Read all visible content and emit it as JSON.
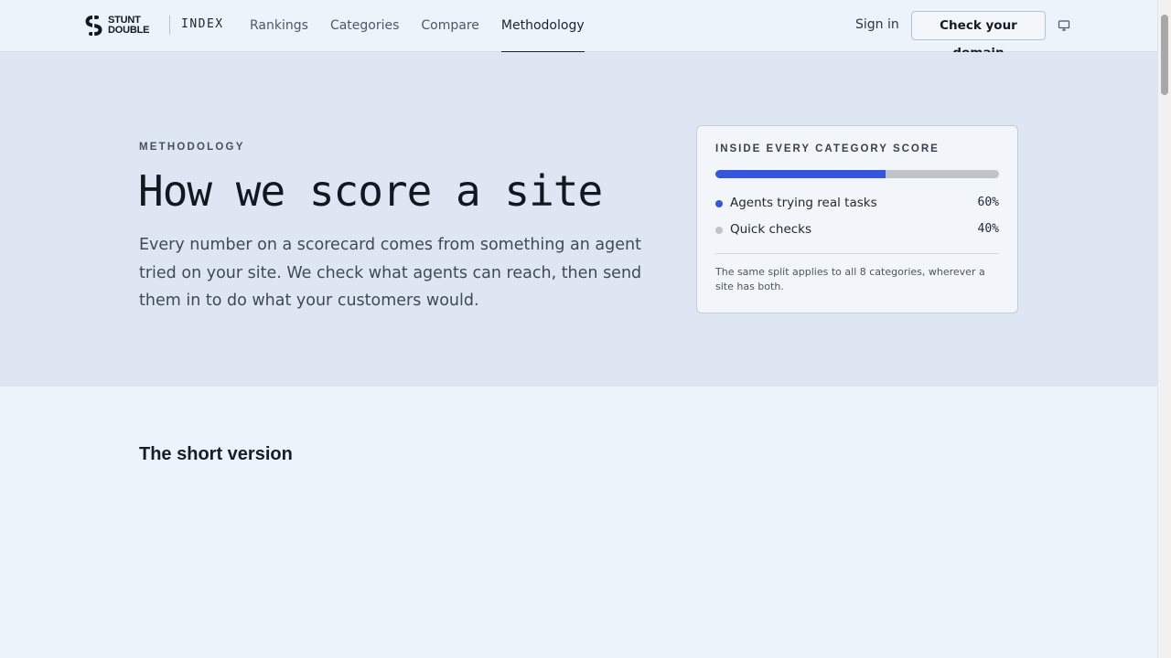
{
  "header": {
    "brand_line1": "STUNT",
    "brand_line2": "DOUBLE",
    "brand_index": "INDEX",
    "nav": [
      "Rankings",
      "Categories",
      "Compare",
      "Methodology"
    ],
    "active_nav": "Methodology",
    "signin_label": "Sign in",
    "cta_label": "Check your domain"
  },
  "hero": {
    "eyebrow": "METHODOLOGY",
    "title": "How we score a site",
    "description": "Every number on a scorecard comes from something an agent tried on your site. We check what agents can reach, then send them in to do what your customers would."
  },
  "score_card": {
    "title": "INSIDE EVERY CATEGORY SCORE",
    "items": [
      {
        "label": "Agents trying real tasks",
        "percent": "60%",
        "value": 60,
        "color": "#3555dc"
      },
      {
        "label": "Quick checks",
        "percent": "40%",
        "value": 40,
        "color": "#bfc4cb"
      }
    ],
    "note": "The same split applies to all 8 categories, wherever a site has both."
  },
  "short_version": {
    "title": "The short version"
  }
}
